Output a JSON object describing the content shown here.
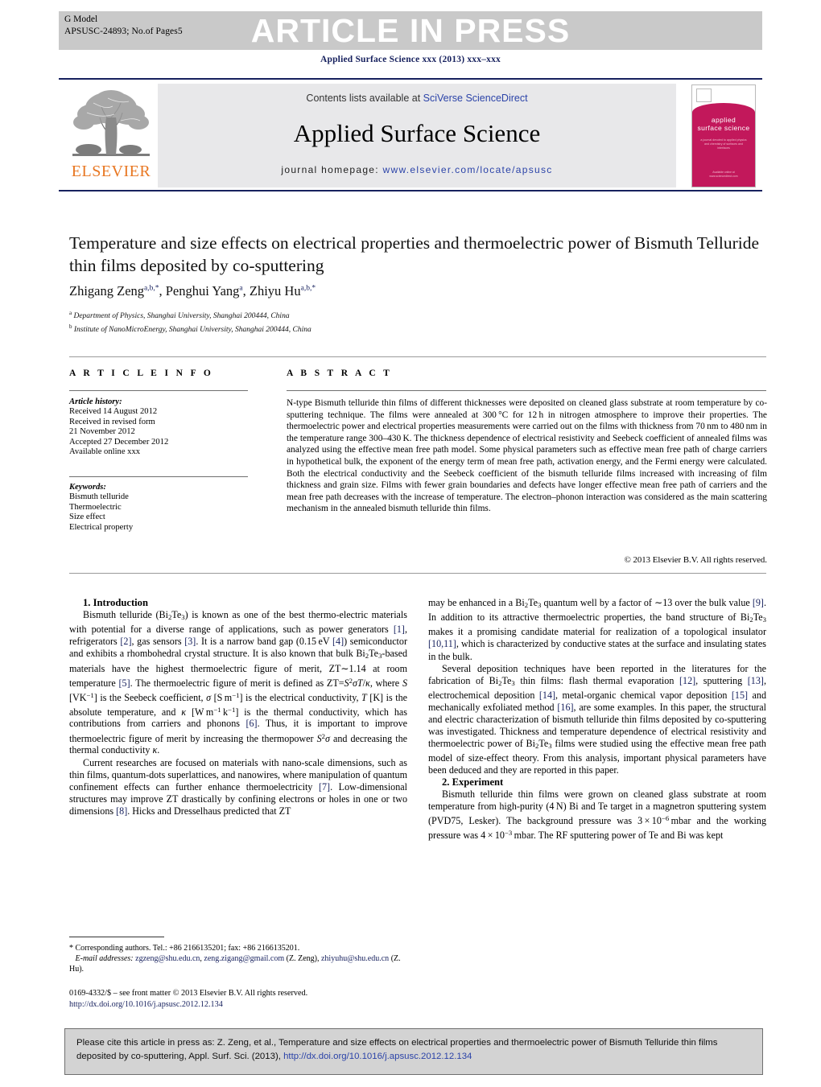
{
  "header": {
    "g_model_line1": "G Model",
    "g_model_line2": "APSUSC-24893;  No.of Pages5",
    "banner": "ARTICLE IN PRESS",
    "journal_citation": "Applied Surface Science xxx (2013) xxx–xxx"
  },
  "sciencedirect": {
    "contents_prefix": "Contents lists available at ",
    "contents_link": "SciVerse ScienceDirect",
    "journal_name": "Applied Surface Science",
    "homepage_prefix": "journal homepage: ",
    "homepage_url": "www.elsevier.com/locate/apsusc",
    "publisher_logo": "ELSEVIER",
    "cover_title_line1": "applied",
    "cover_title_line2": "surface science",
    "cover_subtitle": "a journal devoted to applied physics and chemistry of surfaces and interfaces",
    "cover_footer": "Available online at www.sciencedirect.com"
  },
  "article": {
    "title": "Temperature and size effects on electrical properties and thermoelectric power of Bismuth Telluride thin films deposited by co-sputtering",
    "authors_html": "Zhigang Zeng<sup>a,b,*</sup>, Penghui Yang<sup>a</sup>, Zhiyu Hu<sup>a,b,*</sup>",
    "affiliation_a": "Department of Physics, Shanghai University, Shanghai 200444, China",
    "affiliation_b": "Institute of NanoMicroEnergy, Shanghai University, Shanghai 200444, China"
  },
  "article_info": {
    "heading": "A R T I C L E   I N F O",
    "history_label": "Article history:",
    "history": [
      "Received 14 August 2012",
      "Received in revised form",
      "21 November 2012",
      "Accepted 27 December 2012",
      "Available online xxx"
    ],
    "keywords_label": "Keywords:",
    "keywords": [
      "Bismuth telluride",
      "Thermoelectric",
      "Size effect",
      "Electrical property"
    ]
  },
  "abstract": {
    "heading": "A B S T R A C T",
    "text": "N-type Bismuth telluride thin films of different thicknesses were deposited on cleaned glass substrate at room temperature by co-sputtering technique. The films were annealed at 300 °C for 12 h in nitrogen atmosphere to improve their properties. The thermoelectric power and electrical properties measurements were carried out on the films with thickness from 70 nm to 480 nm in the temperature range 300–430 K. The thickness dependence of electrical resistivity and Seebeck coefficient of annealed films was analyzed using the effective mean free path model. Some physical parameters such as effective mean free path of charge carriers in hypothetical bulk, the exponent of the energy term of mean free path, activation energy, and the Fermi energy were calculated. Both the electrical conductivity and the Seebeck coefficient of the bismuth telluride films increased with increasing of film thickness and grain size. Films with fewer grain boundaries and defects have longer effective mean free path of carriers and the mean free path decreases with the increase of temperature. The electron–phonon interaction was considered as the main scattering mechanism in the annealed bismuth telluride thin films.",
    "copyright": "© 2013 Elsevier B.V. All rights reserved."
  },
  "sections": {
    "introduction_heading": "1.  Introduction",
    "experiment_heading": "2.  Experiment"
  },
  "body": {
    "intro_p1": "Bismuth telluride (Bi<sub>2</sub>Te<sub>3</sub>) is known as one of the best thermo-electric materials with potential for a diverse range of applications, such as power generators <span class=\"ref\">[1]</span>, refrigerators <span class=\"ref\">[2]</span>, gas sensors <span class=\"ref\">[3]</span>. It is a narrow band gap (0.15 eV <span class=\"ref\">[4]</span>) semiconductor and exhibits a rhombohedral crystal structure. It is also known that bulk Bi<sub>2</sub>Te<sub>3</sub>-based materials have the highest thermoelectric figure of merit, ZT∼1.14 at room temperature <span class=\"ref\">[5]</span>. The thermoelectric figure of merit is defined as ZT=<span class=\"it\">S</span><sup class=\"n\">2</sup><span class=\"it\">σT</span>/<span class=\"it\">κ</span>, where <span class=\"it\">S</span> [VK<sup class=\"n\">−1</sup>] is the Seebeck coefficient, <span class=\"it\">σ</span> [S m<sup class=\"n\">−1</sup>] is the electrical conductivity, <span class=\"it\">T</span> [K] is the absolute temperature, and <span class=\"it\">κ</span> [W m<sup class=\"n\">−1</sup> k<sup class=\"n\">−1</sup>] is the thermal conductivity, which has contributions from carriers and phonons <span class=\"ref\">[6]</span>. Thus, it is important to improve thermoelectric figure of merit by increasing the thermopower <span class=\"it\">S</span><sup class=\"n\">2</sup><span class=\"it\">σ</span> and decreasing the thermal conductivity <span class=\"it\">κ</span>.",
    "intro_p2": "Current researches are focused on materials with nano-scale dimensions, such as thin films, quantum-dots superlattices, and nanowires, where manipulation of quantum confinement effects can further enhance thermoelectricity <span class=\"ref\">[7]</span>. Low-dimensional structures may improve ZT drastically by confining electrons or holes in one or two dimensions <span class=\"ref\">[8]</span>. Hicks and Dresselhaus predicted that ZT",
    "intro_p3": "may be enhanced in a Bi<sub>2</sub>Te<sub>3</sub> quantum well by a factor of ∼13 over the bulk value <span class=\"ref\">[9]</span>. In addition to its attractive thermoelectric properties, the band structure of Bi<sub>2</sub>Te<sub>3</sub> makes it a promising candidate material for realization of a topological insulator <span class=\"ref\">[10,11]</span>, which is characterized by conductive states at the surface and insulating states in the bulk.",
    "intro_p4": "Several deposition techniques have been reported in the literatures for the fabrication of Bi<sub>2</sub>Te<sub>3</sub> thin films: flash thermal evaporation <span class=\"ref\">[12]</span>, sputtering <span class=\"ref\">[13]</span>, electrochemical deposition <span class=\"ref\">[14]</span>, metal-organic chemical vapor deposition <span class=\"ref\">[15]</span> and mechanically exfoliated method <span class=\"ref\">[16]</span>, are some examples. In this paper, the structural and electric characterization of bismuth telluride thin films deposited by co-sputtering was investigated. Thickness and temperature dependence of electrical resistivity and thermoelectric power of Bi<sub>2</sub>Te<sub>3</sub> films were studied using the effective mean free path model of size-effect theory. From this analysis, important physical parameters have been deduced and they are reported in this paper.",
    "exp_p1": "Bismuth telluride thin films were grown on cleaned glass substrate at room temperature from high-purity (4 N) Bi and Te target in a magnetron sputtering system (PVD75, Lesker). The background pressure was 3 × 10<sup class=\"n\">−6</sup> mbar and the working pressure was 4 × 10<sup class=\"n\">−3</sup> mbar. The RF sputtering power of Te and Bi was kept"
  },
  "footnote": {
    "corresponding": "* Corresponding authors. Tel.: +86 2166135201; fax: +86 2166135201.",
    "email_label": "E-mail addresses:",
    "email_1": "zgzeng@shu.edu.cn",
    "email_2": "zeng.zigang@gmail.com",
    "email_1_attrib": "(Z. Zeng),",
    "email_3": "zhiyuhu@shu.edu.cn",
    "email_3_attrib": "(Z. Hu).",
    "front_matter": "0169-4332/$ – see front matter © 2013 Elsevier B.V. All rights reserved.",
    "doi": "http://dx.doi.org/10.1016/j.apsusc.2012.12.134"
  },
  "cite_box": {
    "text": "Please cite this article in press as: Z. Zeng, et al., Temperature and size effects on electrical properties and thermoelectric power of Bismuth Telluride thin films deposited by co-sputtering, Appl. Surf. Sci. (2013),",
    "doi": "http://dx.doi.org/10.1016/j.apsusc.2012.12.134"
  },
  "colors": {
    "banner_bg": "#c9c9c9",
    "link": "#2b43a8",
    "reference": "#17215e",
    "elsevier_orange": "#e87722",
    "cover_magenta": "#c2185b",
    "cite_box_bg": "#d3d3d3"
  }
}
